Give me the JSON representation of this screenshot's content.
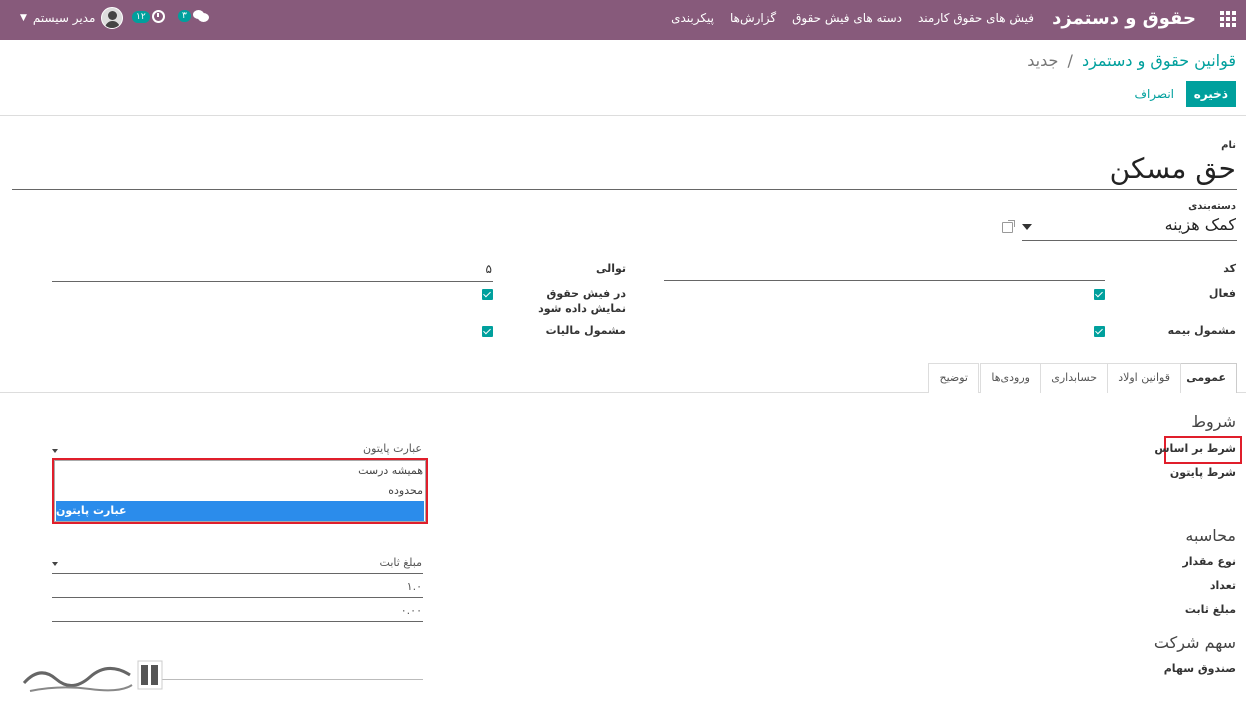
{
  "navbar": {
    "brand": "حقوق و دستمزد",
    "menu": [
      "فیش های حقوق کارمند",
      "دسته های فیش حقوق",
      "گزارش‌ها",
      "پیکربندی"
    ],
    "user_name": "مدیر سیستم",
    "activity_count": "۱۲",
    "message_count": "۳"
  },
  "breadcrumb": {
    "parent": "قوانین حقوق و دستمزد",
    "separator": "/",
    "current": "جدید"
  },
  "actions": {
    "save_label": "ذخیره",
    "discard_label": "انصراف"
  },
  "form": {
    "name_label": "نام",
    "name_value": "حق مسکن",
    "category_label": "دسته‌بندی",
    "category_value": "کمک هزینه",
    "code_label": "کد",
    "sequence_label": "توالی",
    "sequence_value": "۵",
    "active_label": "فعال",
    "show_on_payslip_label": "در فیش حقوق نمایش داده شود",
    "insurance_label": "مشمول بیمه",
    "tax_label": "مشمول مالیات"
  },
  "tabs": [
    "عمومی",
    "قوانین اولاد",
    "حسابداری",
    "ورودی‌ها",
    "توضیح"
  ],
  "conditions": {
    "title": "شروط",
    "based_on_label": "شرط بر اساس",
    "based_on_value": "عبارت پایتون",
    "python_condition_label": "شرط پایتون",
    "dropdown_options": [
      "همیشه درست",
      "محدوده",
      "عبارت پایتون"
    ],
    "selected_option": "عبارت پایتون"
  },
  "computation": {
    "title": "محاسبه",
    "amount_type_label": "نوع مقدار",
    "amount_type_value": "مبلغ ثابت",
    "quantity_label": "تعداد",
    "quantity_value": "۱.۰",
    "fixed_amount_label": "مبلغ ثابت",
    "fixed_amount_value": "۰.۰۰"
  },
  "company_share": {
    "title": "سهم شرکت",
    "fund_label": "صندوق سهام"
  },
  "colors": {
    "navbar": "#875a7b",
    "accent": "#00a09d",
    "highlight": "#e01e2b",
    "selected_option": "#2b8ceb"
  }
}
